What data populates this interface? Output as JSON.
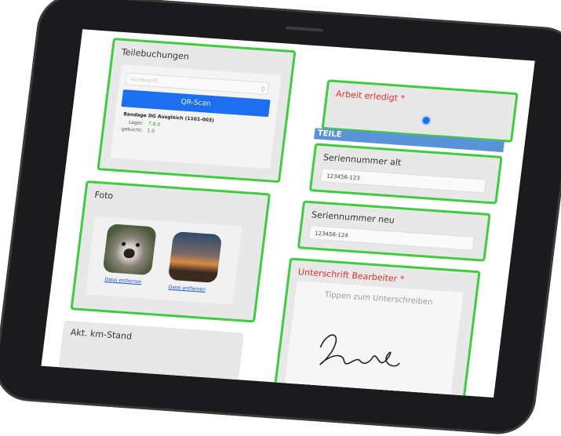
{
  "teilebuchungen": {
    "title": "Teilebuchungen",
    "search_placeholder": "Suchbegriff...",
    "qr_button": "QR-Scan",
    "part_name": "Bandage DG Ausgleich (1101-003)",
    "lager_label": "Lager:",
    "lager_value": "7.8.0",
    "gebucht_label": "gebucht:",
    "gebucht_value": "1.0"
  },
  "foto": {
    "title": "Foto",
    "photos": [
      {
        "remove_label": "Datei entfernen",
        "icon": "koala-photo"
      },
      {
        "remove_label": "Datei entfernen",
        "icon": "sunset-photo"
      }
    ]
  },
  "km": {
    "title": "Akt. km-Stand"
  },
  "arbeit": {
    "title": "Arbeit erledigt *",
    "selected": true
  },
  "teile_header": "TEILE",
  "serial_old": {
    "label": "Seriennummer alt",
    "value": "123456-123"
  },
  "serial_new": {
    "label": "Seriennummer neu",
    "value": "123456-124"
  },
  "signature": {
    "label": "Unterschrift Bearbeiter *",
    "hint": "Tippen zum Unterschreiben"
  },
  "colors": {
    "highlight_border": "#3fcc3f",
    "primary_blue": "#1e6ff0",
    "required_red": "#e0322d",
    "section_header": "#5b93d8"
  }
}
